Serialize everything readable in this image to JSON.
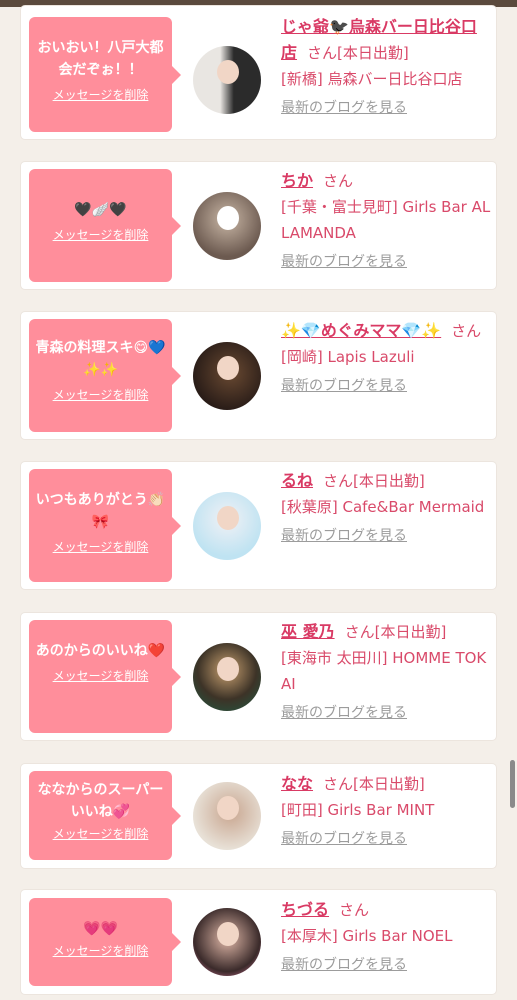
{
  "cards": [
    {
      "message": "おいおい！八戸大都会だぞぉ！！",
      "delete_label": "メッセージを削除",
      "name": "じゃ爺🐦‍⬛烏森バー日比谷口店",
      "honorific": "さん",
      "status": "[本日出勤]",
      "shop": "[新橋] 烏森バー日比谷口店",
      "blog_label": "最新のブログを見る",
      "avatar_colors": [
        "#e9e6e2",
        "#2b2b2b"
      ]
    },
    {
      "message": "🖤🪽🖤",
      "delete_label": "メッセージを削除",
      "name": "ちか",
      "honorific": "さん",
      "status": "",
      "shop": "[千葉・富士見町] Girls Bar ALLAMANDA",
      "blog_label": "最新のブログを見る",
      "avatar_colors": [
        "#6c5a50",
        "#c9b7a6"
      ]
    },
    {
      "message": "青森の料理スキ😋💙✨✨",
      "delete_label": "メッセージを削除",
      "name": "✨💎めぐみママ💎✨",
      "honorific": "さん",
      "status": "",
      "shop": "[岡崎] Lapis Lazuli",
      "blog_label": "最新のブログを見る",
      "avatar_colors": [
        "#2a1d18",
        "#6a4a32"
      ]
    },
    {
      "message": "いつもありがとう👏🏻🎀",
      "delete_label": "メッセージを削除",
      "name": "るね",
      "honorific": "さん",
      "status": "[本日出勤]",
      "shop": "[秋葉原] Cafe&Bar Mermaid",
      "blog_label": "最新のブログを見る",
      "avatar_colors": [
        "#bfe3f2",
        "#f1f1f5"
      ]
    },
    {
      "message": "あのからのいいね❤️",
      "delete_label": "メッセージを削除",
      "name": "巫 愛乃",
      "honorific": "さん",
      "status": "[本日出勤]",
      "shop": "[東海市 太田川] HOMME TOKAI",
      "blog_label": "最新のブログを見る",
      "avatar_colors": [
        "#3d3327",
        "#1f5a43"
      ]
    },
    {
      "message": "ななからのスーパーいいね💞",
      "delete_label": "メッセージを削除",
      "name": "なな",
      "honorific": "さん",
      "status": "[本日出勤]",
      "shop": "[町田] Girls Bar MINT",
      "blog_label": "最新のブログを見る",
      "avatar_colors": [
        "#e8e1d7",
        "#c8a58f"
      ]
    },
    {
      "message": "💗💗",
      "delete_label": "メッセージを削除",
      "name": "ちづる",
      "honorific": "さん",
      "status": "",
      "shop": "[本厚木] Girls Bar NOEL",
      "blog_label": "最新のブログを見る",
      "avatar_colors": [
        "#3a2a2a",
        "#e87da6"
      ]
    }
  ],
  "colors": {
    "background": "#f4efe9",
    "bubble": "#ff8e9b",
    "name": "#d93a64",
    "text": "#d94a6a",
    "link_gray": "#9c9c9c"
  }
}
